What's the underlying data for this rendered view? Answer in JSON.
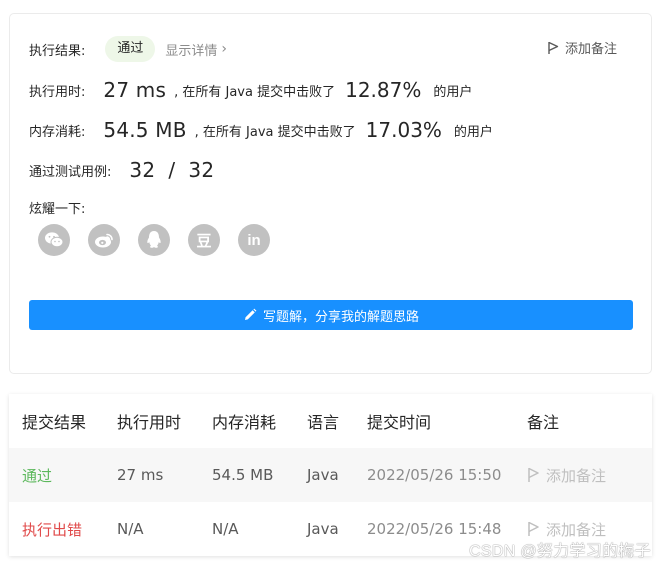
{
  "result": {
    "label": "执行结果:",
    "status": "通过",
    "detail_link": "显示详情",
    "add_note": "添加备注",
    "runtime": {
      "label": "执行用时:",
      "value": "27 ms",
      "sep_text": ", 在所有 Java 提交中击败了",
      "percent": "12.87%",
      "suffix": "的用户"
    },
    "memory": {
      "label": "内存消耗:",
      "value": "54.5 MB",
      "sep_text": ", 在所有 Java 提交中击败了",
      "percent": "17.03%",
      "suffix": "的用户"
    },
    "tests": {
      "label": "通过测试用例:",
      "value": "32  /  32"
    },
    "share_label": "炫耀一下:",
    "share_icons": [
      "wechat-icon",
      "weibo-icon",
      "qq-icon",
      "douban-icon",
      "linkedin-icon"
    ],
    "douban_glyph": "豆",
    "linkedin_glyph": "in",
    "write_button": "写题解，分享我的解题思路",
    "colors": {
      "accent": "#1890ff",
      "pass_badge_bg": "#eef7e8"
    }
  },
  "submissions": {
    "columns": [
      "提交结果",
      "执行用时",
      "内存消耗",
      "语言",
      "提交时间",
      "备注"
    ],
    "rows": [
      {
        "status": "通过",
        "runtime": "27 ms",
        "memory": "54.5 MB",
        "language": "Java",
        "time": "2022/05/26 15:50",
        "note": "添加备注"
      },
      {
        "status": "执行出错",
        "runtime": "N/A",
        "memory": "N/A",
        "language": "Java",
        "time": "2022/05/26 15:48",
        "note": "添加备注"
      }
    ],
    "colors": {
      "ok": "#5cb85c",
      "error": "#e04a4a"
    }
  },
  "watermark": "CSDN @努力学习的梅子"
}
